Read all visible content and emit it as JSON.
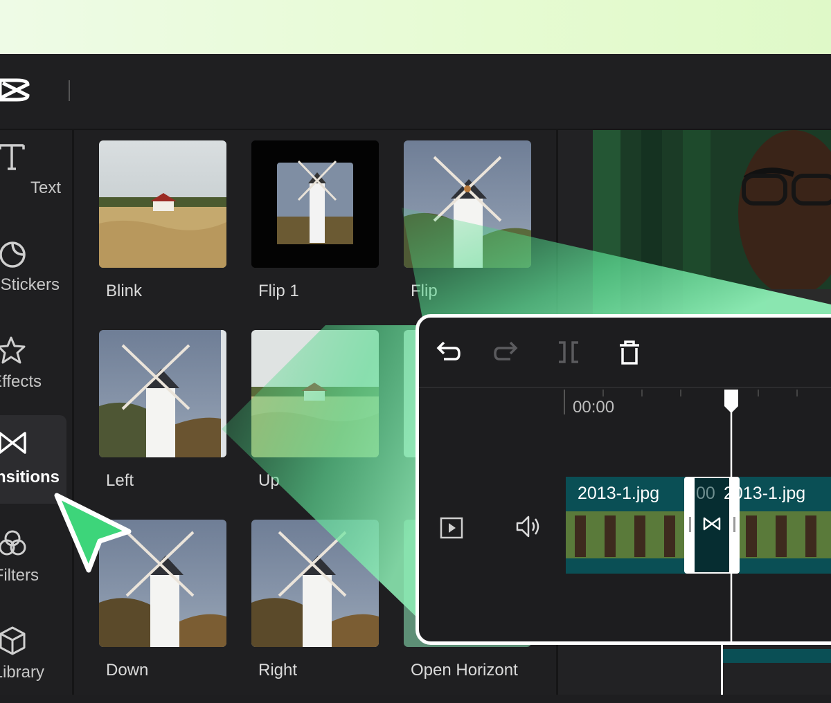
{
  "sidebar": {
    "items": [
      {
        "label": "Text",
        "icon": "text-icon"
      },
      {
        "label": "Stickers",
        "icon": "sticker-icon"
      },
      {
        "label": "Effects",
        "icon": "star-icon"
      },
      {
        "label": "Transitions",
        "icon": "transition-icon"
      },
      {
        "label": "Filters",
        "icon": "filter-icon"
      },
      {
        "label": "Library",
        "icon": "cube-icon"
      }
    ]
  },
  "transitions": [
    {
      "label": "Blink"
    },
    {
      "label": "Flip 1"
    },
    {
      "label": "Flip"
    },
    {
      "label": "Left"
    },
    {
      "label": "Up"
    },
    {
      "label": "Down"
    },
    {
      "label": "Right"
    },
    {
      "label": "Open Horizont"
    }
  ],
  "timeline": {
    "time": "00:00",
    "clip_left": "2013-1.jpg",
    "clip_right": "2013-1.jpg",
    "clip_overlap": "00"
  },
  "colors": {
    "accent": "#3dd57a",
    "clip_bg": "#0a4f55",
    "panel": "#1f1f21"
  }
}
